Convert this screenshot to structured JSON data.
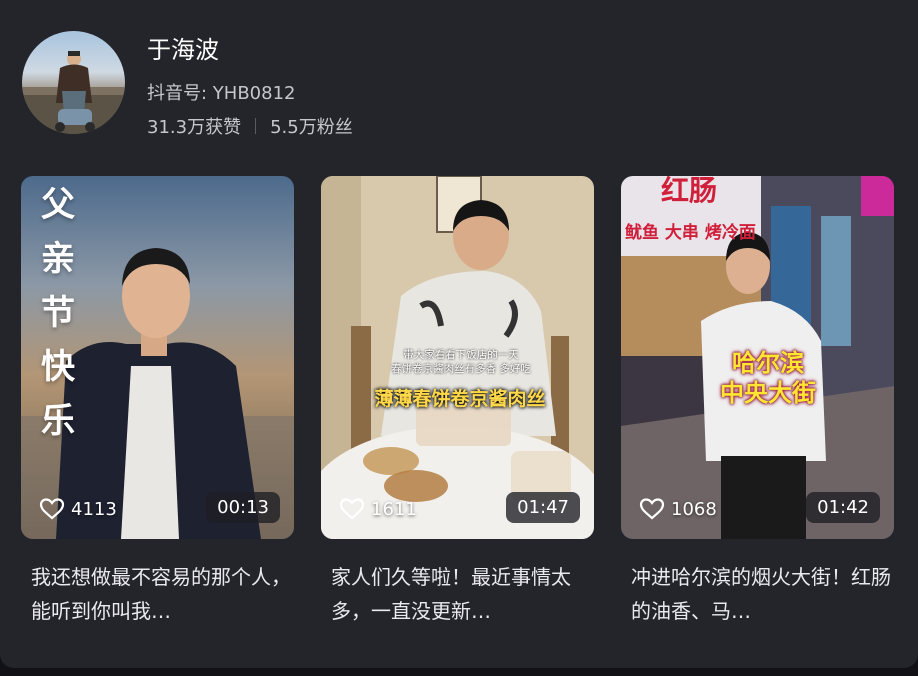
{
  "profile": {
    "name": "于海波",
    "douyin_id": "抖音号: YHB0812",
    "likes": "31.3万获赞",
    "followers": "5.5万粉丝"
  },
  "videos": [
    {
      "title_text": "父亲节快乐",
      "title_chars": [
        "父",
        "亲",
        "节",
        "快",
        "乐"
      ],
      "likes": "4113",
      "duration": "00:13",
      "caption": "我还想做最不容易的那个人，能听到你叫我…"
    },
    {
      "overlay_small_1": "带大家看看下饭店的一天",
      "overlay_small_2": "春饼卷京酱肉丝有多香 多好吃",
      "overlay_title": "薄薄春饼卷京酱肉丝",
      "likes": "1611",
      "duration": "01:47",
      "caption": "家人们久等啦！最近事情太多，一直没更新…"
    },
    {
      "sign_text": "红肠",
      "sign_sub": "鱿鱼 大串 烤冷面",
      "overlay_line1": "哈尔滨",
      "overlay_line2": "中央大街",
      "likes": "1068",
      "duration": "01:42",
      "caption": "冲进哈尔滨的烟火大街！红肠的油香、马…"
    }
  ],
  "colors": {
    "background": "#24242b",
    "text_primary": "#ffffff",
    "text_secondary": "#c6c6cc",
    "overlay_yellow": "#ffd84a"
  },
  "icons": [
    "heart-outline-icon"
  ]
}
